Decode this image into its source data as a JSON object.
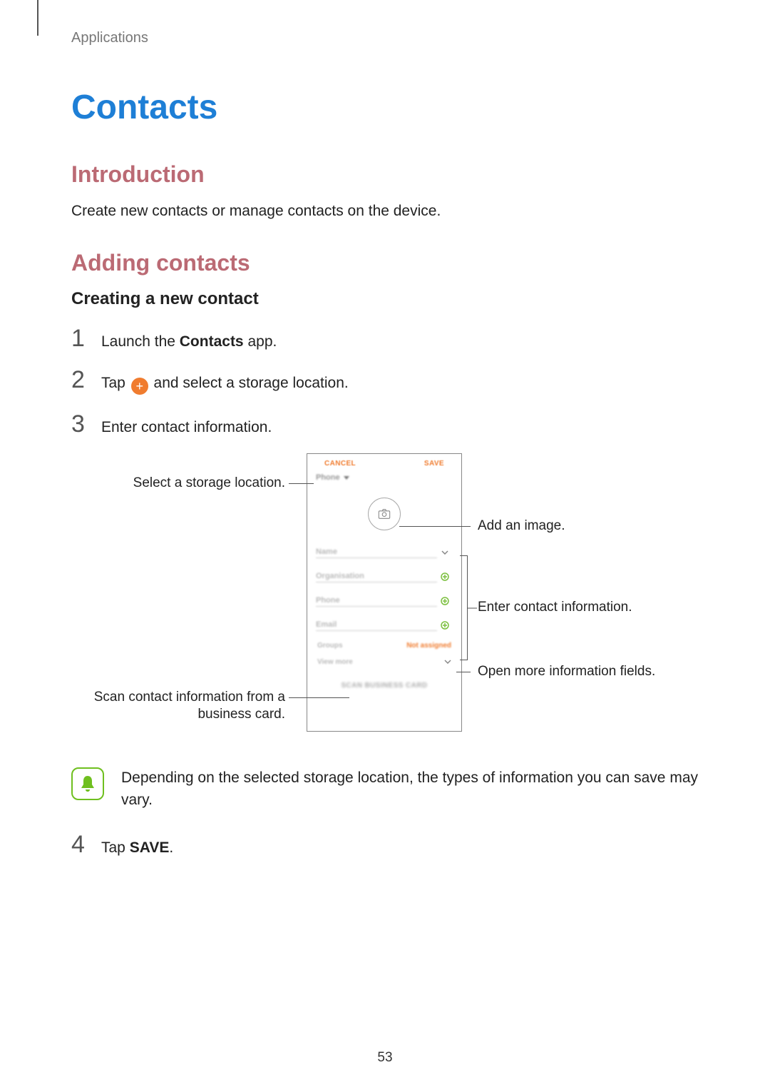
{
  "breadcrumb": "Applications",
  "title": "Contacts",
  "intro_heading": "Introduction",
  "intro_text": "Create new contacts or manage contacts on the device.",
  "adding_heading": "Adding contacts",
  "creating_heading": "Creating a new contact",
  "steps": {
    "s1_num": "1",
    "s1_a": "Launch the ",
    "s1_bold": "Contacts",
    "s1_b": " app.",
    "s2_num": "2",
    "s2_a": "Tap ",
    "s2_b": " and select a storage location.",
    "s3_num": "3",
    "s3_text": "Enter contact information.",
    "s4_num": "4",
    "s4_a": "Tap ",
    "s4_bold": "SAVE",
    "s4_b": "."
  },
  "diagram": {
    "callout_storage": "Select a storage location.",
    "callout_image": "Add an image.",
    "callout_info": "Enter contact information.",
    "callout_more": "Open more information fields.",
    "callout_scan_a": "Scan contact information from a",
    "callout_scan_b": "business card.",
    "phone": {
      "cancel": "CANCEL",
      "save": "SAVE",
      "storage": "Phone",
      "name": "Name",
      "organisation": "Organisation",
      "phone": "Phone",
      "email": "Email",
      "groups": "Groups",
      "groups_val": "Not assigned",
      "view_more": "View more",
      "scan": "SCAN BUSINESS CARD"
    }
  },
  "note_text": "Depending on the selected storage location, the types of information you can save may vary.",
  "page_number": "53"
}
